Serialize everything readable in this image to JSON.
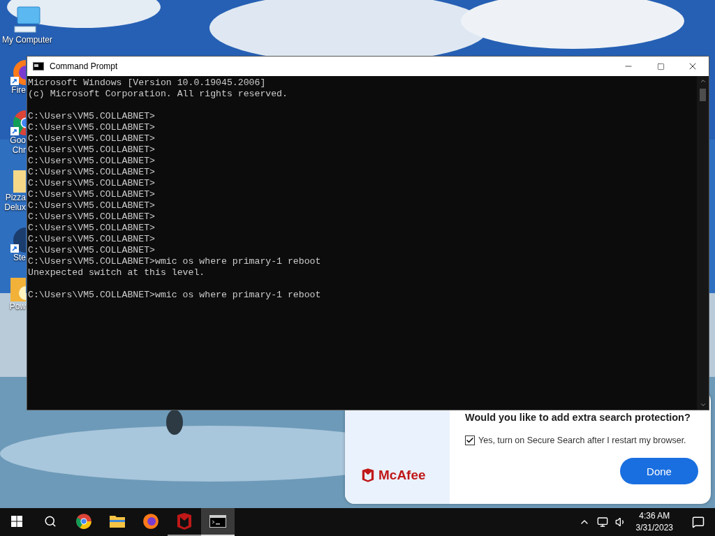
{
  "desktop_icons": [
    {
      "kind": "computer",
      "lines": [
        "My Computer"
      ],
      "shortcut": false
    },
    {
      "kind": "firefox",
      "lines": [
        "Fire"
      ],
      "shortcut": true
    },
    {
      "kind": "chrome",
      "lines": [
        "Goo",
        "Chr"
      ],
      "shortcut": true
    },
    {
      "kind": "folder",
      "lines": [
        "Pizza",
        "Delux"
      ],
      "shortcut": false
    },
    {
      "kind": "steam",
      "lines": [
        "Ste"
      ],
      "shortcut": true
    },
    {
      "kind": "game",
      "lines": [
        "Pow"
      ],
      "shortcut": false
    }
  ],
  "window": {
    "title": "Command Prompt",
    "blocks": [
      [
        "Microsoft Windows [Version 10.0.19045.2006]",
        "(c) Microsoft Corporation. All rights reserved."
      ],
      [
        "C:\\Users\\VM5.COLLABNET>",
        "C:\\Users\\VM5.COLLABNET>",
        "C:\\Users\\VM5.COLLABNET>",
        "C:\\Users\\VM5.COLLABNET>",
        "C:\\Users\\VM5.COLLABNET>",
        "C:\\Users\\VM5.COLLABNET>",
        "C:\\Users\\VM5.COLLABNET>",
        "C:\\Users\\VM5.COLLABNET>",
        "C:\\Users\\VM5.COLLABNET>",
        "C:\\Users\\VM5.COLLABNET>",
        "C:\\Users\\VM5.COLLABNET>",
        "C:\\Users\\VM5.COLLABNET>",
        "C:\\Users\\VM5.COLLABNET>",
        "C:\\Users\\VM5.COLLABNET>wmic os where primary-1 reboot",
        "Unexpected switch at this level."
      ],
      [
        "C:\\Users\\VM5.COLLABNET>wmic os where primary-1 reboot"
      ]
    ]
  },
  "popup": {
    "brand": "McAfee",
    "heading": "Would you like to add extra search protection?",
    "checkbox": {
      "label": "Yes, turn on Secure Search after I restart my browser.",
      "checked": true
    },
    "button": "Done"
  },
  "taskbar": {
    "apps": [
      {
        "kind": "chrome",
        "selected": false,
        "running": false
      },
      {
        "kind": "explorer",
        "selected": false,
        "running": false
      },
      {
        "kind": "firefox",
        "selected": false,
        "running": false
      },
      {
        "kind": "mcafee",
        "selected": false,
        "running": true
      },
      {
        "kind": "cmd",
        "selected": true,
        "running": true
      }
    ],
    "time": "4:36 AM",
    "date": "3/31/2023"
  }
}
